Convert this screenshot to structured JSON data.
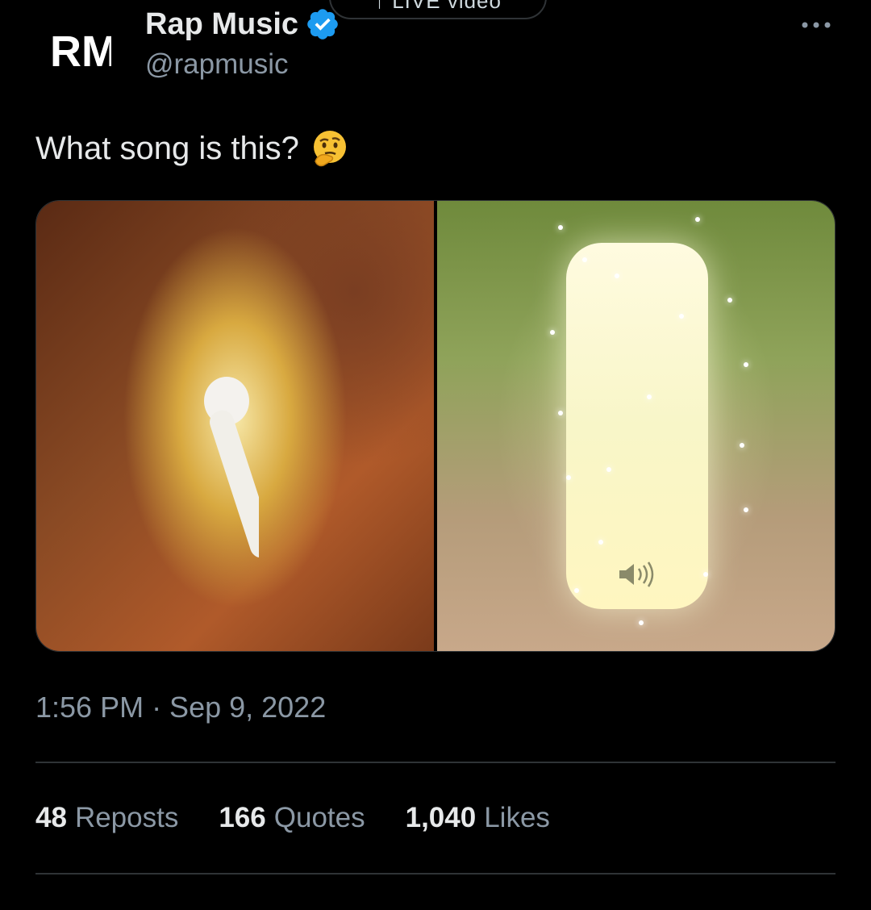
{
  "top_pill": {
    "label": "↑ LIVE video"
  },
  "author": {
    "display_name": "Rap Music",
    "handle": "@rapmusic",
    "avatar_text": "RM",
    "verified": true
  },
  "tweet": {
    "text": "What song is this?",
    "emoji": "thinking-face-icon",
    "timestamp": "1:56 PM · Sep 9, 2022"
  },
  "stats": [
    {
      "count": "48",
      "label": "Reposts"
    },
    {
      "count": "166",
      "label": "Quotes"
    },
    {
      "count": "1,040",
      "label": "Likes"
    }
  ],
  "colors": {
    "background": "#000000",
    "text_primary": "#e7e9ea",
    "text_secondary": "#8b98a5",
    "separator": "#2f3336",
    "verified": "#1d9bf0"
  }
}
